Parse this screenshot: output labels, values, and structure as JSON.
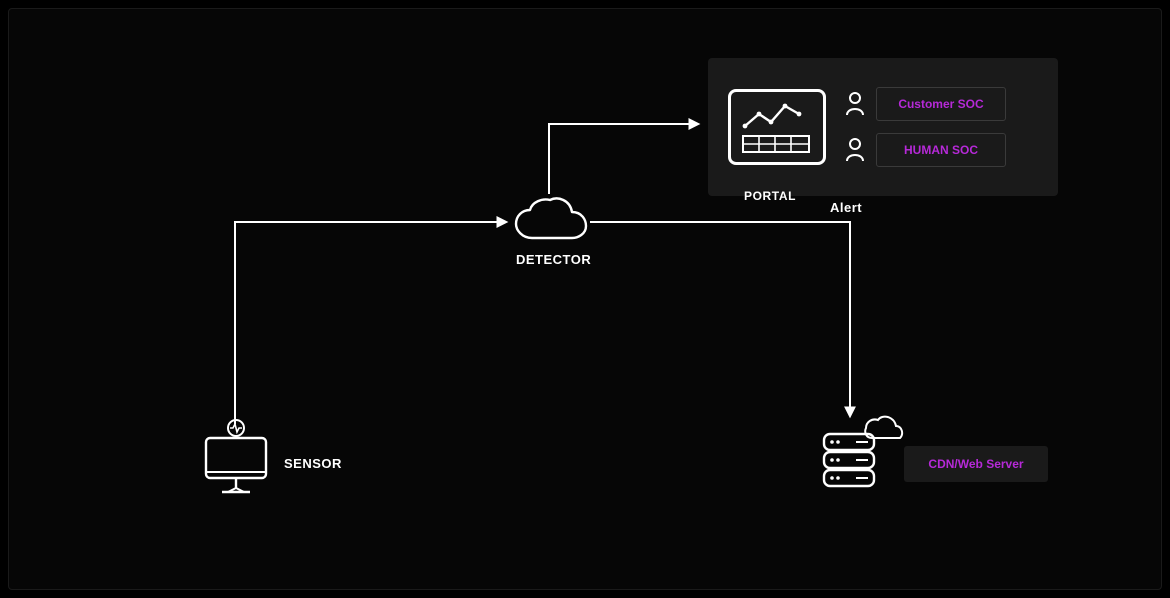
{
  "labels": {
    "sensor": "SENSOR",
    "detector": "DETECTOR",
    "alert": "Alert",
    "portal": "PORTAL"
  },
  "soc": {
    "customer": "Customer SOC",
    "human": "HUMAN SOC"
  },
  "cdn": {
    "label": "CDN/Web Server"
  }
}
